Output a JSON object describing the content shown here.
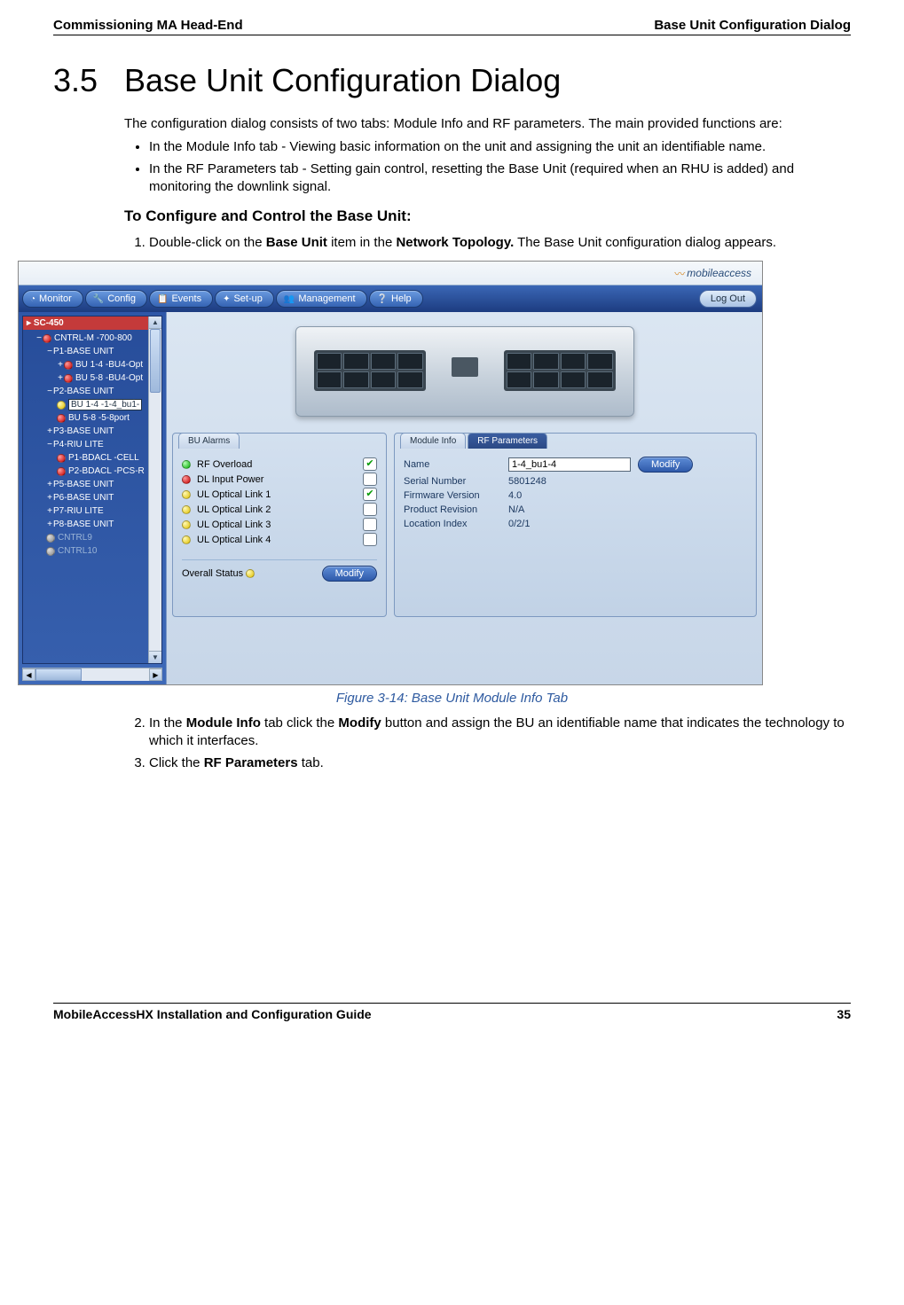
{
  "header": {
    "left": "Commissioning MA Head-End",
    "right": "Base Unit Configuration Dialog"
  },
  "section": {
    "number": "3.5",
    "title": "Base Unit Configuration Dialog"
  },
  "intro": "The configuration dialog consists of two tabs: Module Info and RF parameters. The main provided functions are:",
  "bullets": {
    "b1": "In the Module Info tab - Viewing basic information on the unit and assigning the unit an identifiable name.",
    "b2": "In the RF Parameters tab - Setting gain control, resetting the Base Unit (required when an RHU is added) and monitoring the downlink signal."
  },
  "subheading": "To Configure and Control the Base Unit:",
  "steps": {
    "s1_a": "Double-click on the ",
    "s1_b": "Base Unit",
    "s1_c": " item in the ",
    "s1_d": "Network Topology.",
    "s1_e": " The Base Unit configuration dialog appears.",
    "s2_a": "In the ",
    "s2_b": "Module Info",
    "s2_c": " tab click the ",
    "s2_d": "Modify",
    "s2_e": " button and assign the BU an identifiable name that indicates the technology to which it interfaces.",
    "s3_a": "Click the ",
    "s3_b": "RF Parameters",
    "s3_c": " tab."
  },
  "figure_caption": "Figure 3-14: Base Unit Module Info Tab",
  "app": {
    "brand": "mobileaccess",
    "menu": {
      "monitor": "Monitor",
      "config": "Config",
      "events": "Events",
      "setup": "Set-up",
      "management": "Management",
      "help": "Help",
      "logout": "Log Out"
    },
    "tree_title": "SC-450",
    "tree": {
      "n1": "CNTRL-M -700-800",
      "n2": "P1-BASE UNIT",
      "n3": "BU 1-4 -BU4-Opt",
      "n4": "BU 5-8 -BU4-Opt",
      "n5": "P2-BASE UNIT",
      "n6": "BU 1-4 -1-4_bu1-",
      "n7": "BU 5-8 -5-8port",
      "n8": "P3-BASE UNIT",
      "n9": "P4-RIU LITE",
      "n10": "P1-BDACL -CELL",
      "n11": "P2-BDACL -PCS-R",
      "n12": "P5-BASE UNIT",
      "n13": "P6-BASE UNIT",
      "n14": "P7-RIU LITE",
      "n15": "P8-BASE UNIT",
      "n16": "CNTRL9",
      "n17": "CNTRL10"
    },
    "alarms_tab": "BU Alarms",
    "alarms": {
      "a1": "RF Overload",
      "a2": "DL Input Power",
      "a3": "UL Optical Link 1",
      "a4": "UL Optical Link 2",
      "a5": "UL Optical Link 3",
      "a6": "UL Optical Link 4"
    },
    "overall_label": "Overall Status",
    "modify_label": "Modify",
    "module_tab": "Module Info",
    "rf_tab": "RF Parameters",
    "info": {
      "name_label": "Name",
      "name_value": "1-4_bu1-4",
      "serial_label": "Serial Number",
      "serial_value": "5801248",
      "fw_label": "Firmware Version",
      "fw_value": "4.0",
      "rev_label": "Product Revision",
      "rev_value": "N/A",
      "loc_label": "Location Index",
      "loc_value": "0/2/1"
    }
  },
  "footer": {
    "left": "MobileAccessHX Installation and Configuration Guide",
    "right": "35"
  }
}
